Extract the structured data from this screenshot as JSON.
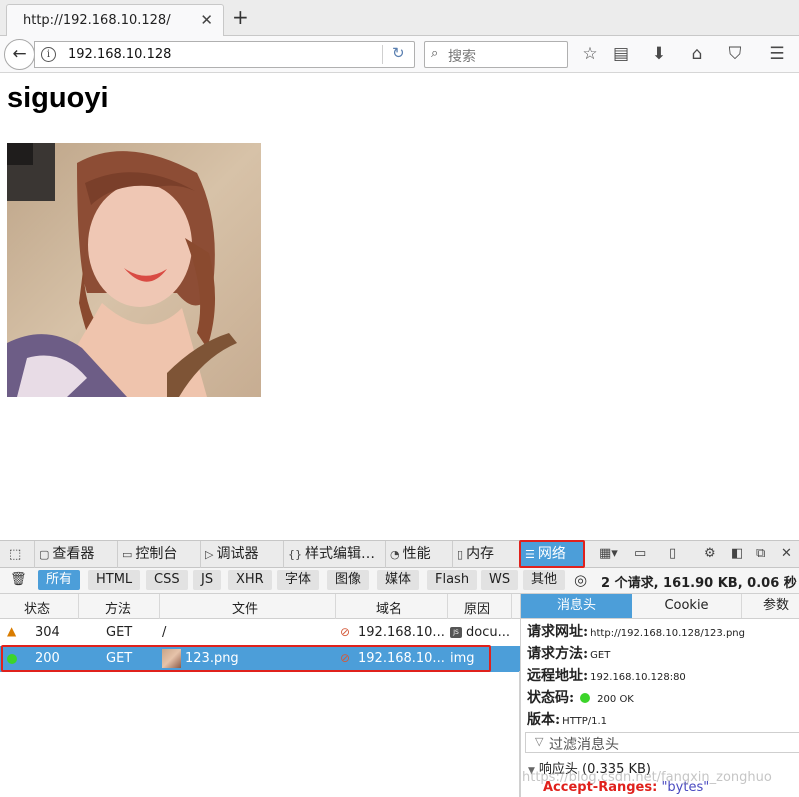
{
  "browser": {
    "tab_title": "http://192.168.10.128/",
    "tab_close": "✕",
    "new_tab": "+",
    "url": "192.168.10.128",
    "search_placeholder": "搜索"
  },
  "page": {
    "heading": "siguoyi"
  },
  "devtools": {
    "tabs": [
      {
        "label": "查看器",
        "icon": "inspector-icon"
      },
      {
        "label": "控制台",
        "icon": "console-icon"
      },
      {
        "label": "调试器",
        "icon": "debugger-icon"
      },
      {
        "label": "样式编辑…",
        "icon": "style-editor-icon"
      },
      {
        "label": "性能",
        "icon": "performance-icon"
      },
      {
        "label": "内存",
        "icon": "memory-icon"
      },
      {
        "label": "网络",
        "icon": "network-icon",
        "selected": true
      }
    ],
    "filters": [
      "所有",
      "HTML",
      "CSS",
      "JS",
      "XHR",
      "字体",
      "图像",
      "媒体",
      "Flash",
      "WS",
      "其他"
    ],
    "active_filter": "所有",
    "summary": "2 个请求, 161.90 KB, 0.06 秒",
    "columns": [
      "状态",
      "方法",
      "文件",
      "域名",
      "原因"
    ],
    "requests": [
      {
        "status": "304",
        "method": "GET",
        "file": "/",
        "domain": "192.168.10...",
        "cause": "docu...",
        "status_kind": "warning"
      },
      {
        "status": "200",
        "method": "GET",
        "file": "123.png",
        "domain": "192.168.10...",
        "cause": "img",
        "status_kind": "ok",
        "selected": true
      }
    ],
    "sidebar": {
      "tabs": [
        "消息头",
        "Cookie",
        "参数"
      ],
      "request_url_label": "请求网址:",
      "request_url": "http://192.168.10.128/123.png",
      "request_method_label": "请求方法:",
      "request_method": "GET",
      "remote_address_label": "远程地址:",
      "remote_address": "192.168.10.128:80",
      "status_code_label": "状态码:",
      "status_code": "200 OK",
      "version_label": "版本:",
      "version": "HTTP/1.1",
      "filter_placeholder": "过滤消息头",
      "response_headers": "响应头 (0.335 KB)",
      "header_name": "Accept-Ranges:",
      "header_value": "\"bytes\""
    },
    "watermark": "https://blog.csdn.net/fangxin_zonghuo"
  },
  "colors": {
    "accent": "#4c9ed9",
    "highlight_box": "#e0211c",
    "status_ok": "#3cd42a",
    "status_warning": "#d97c00"
  }
}
